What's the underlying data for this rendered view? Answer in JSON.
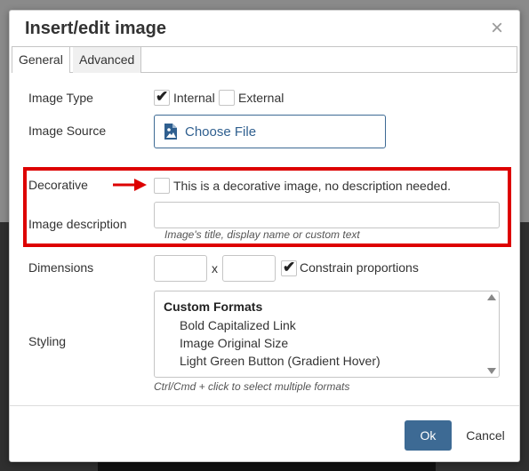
{
  "dialog": {
    "title": "Insert/edit image",
    "close_glyph": "×",
    "tabs": [
      {
        "label": "General",
        "active": true
      },
      {
        "label": "Advanced",
        "active": false
      }
    ]
  },
  "image_type": {
    "label": "Image Type",
    "options": [
      {
        "label": "Internal",
        "checked": true
      },
      {
        "label": "External",
        "checked": false
      }
    ]
  },
  "image_source": {
    "label": "Image Source",
    "button_label": "Choose File",
    "icon": "image-file-icon"
  },
  "decorative": {
    "label": "Decorative",
    "checkbox_label": "This is a decorative image, no description needed.",
    "checked": false,
    "arrow_color": "#dd0000"
  },
  "image_description": {
    "label": "Image description",
    "value": "",
    "hint": "Image's title, display name or custom text"
  },
  "dimensions": {
    "label": "Dimensions",
    "width": "",
    "height": "",
    "separator": "x",
    "constrain_label": "Constrain proportions",
    "constrain_checked": true
  },
  "styling": {
    "label": "Styling",
    "group": "Custom Formats",
    "options": [
      "Bold Capitalized Link",
      "Image Original Size",
      "Light Green Button (Gradient Hover)"
    ],
    "hint": "Ctrl/Cmd + click to select multiple formats"
  },
  "buttons": {
    "ok": "Ok",
    "cancel": "Cancel"
  },
  "colors": {
    "primary": "#3d6a94",
    "highlight": "#dd0000"
  }
}
